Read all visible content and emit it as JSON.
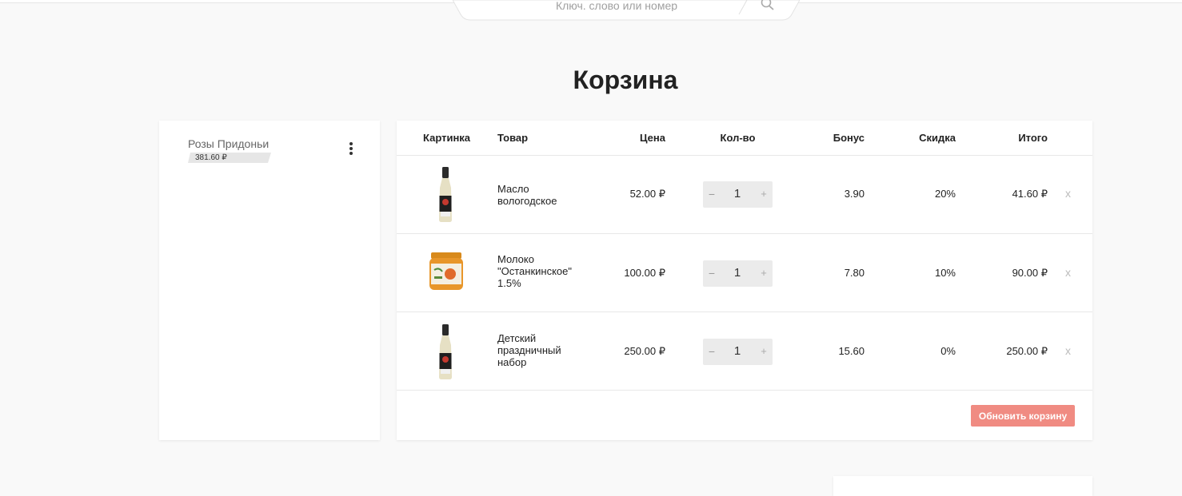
{
  "search": {
    "placeholder": "Ключ. слово или номер",
    "icon": "search-icon"
  },
  "page": {
    "title": "Корзина"
  },
  "cart_list": {
    "items": [
      {
        "name": "Розы Придоньи",
        "total": "381.60 ₽"
      }
    ],
    "menu_icon": "kebab-menu-icon"
  },
  "table": {
    "headers": {
      "image": "Картинка",
      "product": "Товар",
      "price": "Цена",
      "qty": "Кол-во",
      "bonus": "Бонус",
      "discount": "Скидка",
      "total": "Итого"
    },
    "rows": [
      {
        "name": "Масло вологодское",
        "price": "52.00 ₽",
        "qty": "1",
        "bonus": "3.90",
        "discount": "20%",
        "total": "41.60 ₽",
        "remove": "x",
        "image": "sauce-bottle"
      },
      {
        "name": "Молоко \"Останкинское\" 1.5%",
        "price": "100.00 ₽",
        "qty": "1",
        "bonus": "7.80",
        "discount": "10%",
        "total": "90.00 ₽",
        "remove": "x",
        "image": "jam-jar"
      },
      {
        "name": "Детский праздничный набор",
        "price": "250.00 ₽",
        "qty": "1",
        "bonus": "15.60",
        "discount": "0%",
        "total": "250.00 ₽",
        "remove": "x",
        "image": "sauce-bottle"
      }
    ],
    "qty_minus": "−",
    "qty_plus": "+"
  },
  "actions": {
    "update_cart": "Обновить корзину"
  },
  "colors": {
    "accent": "#f08b82",
    "background": "#f9f9f9"
  }
}
